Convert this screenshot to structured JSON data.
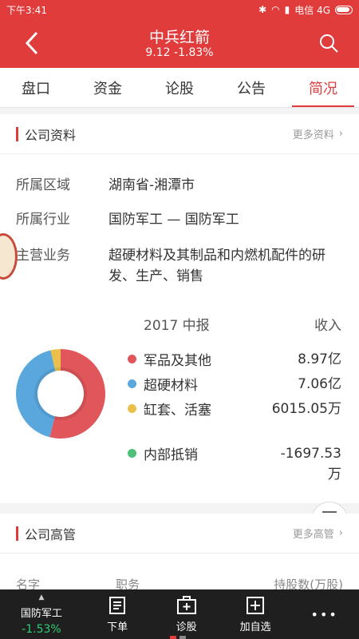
{
  "status": {
    "time": "下午3:41",
    "carrier": "电信 4G"
  },
  "header": {
    "title": "中兵红箭",
    "subtitle": "9.12  -1.83%"
  },
  "tabs": [
    "盘口",
    "资金",
    "论股",
    "公告",
    "简况"
  ],
  "active_tab": "简况",
  "company": {
    "section_title": "公司资料",
    "more_label": "更多资料",
    "region_label": "所属区域",
    "region_value": "湖南省-湘潭市",
    "industry_label": "所属行业",
    "industry_value": "国防军工 — 国防军工",
    "business_label": "主营业务",
    "business_value": "超硬材料及其制品和内燃机配件的研发、生产、销售"
  },
  "revenue": {
    "period": "2017 中报",
    "column": "收入",
    "items": [
      {
        "name": "军品及其他",
        "value": "8.97亿",
        "color": "#e0565a"
      },
      {
        "name": "超硬材料",
        "value": "7.06亿",
        "color": "#5aa7dd"
      },
      {
        "name": "缸套、活塞",
        "value": "6015.05万",
        "color": "#e9c14a"
      },
      {
        "name": "内部抵销",
        "value": "-1697.53万",
        "color": "#4fc07a"
      }
    ]
  },
  "chart_data": {
    "type": "pie",
    "title": "",
    "categories": [
      "军品及其他",
      "超硬材料",
      "缸套、活塞",
      "内部抵销"
    ],
    "values": [
      89700,
      70600,
      6015.05,
      -1697.53
    ],
    "units": "万",
    "colors": [
      "#e0565a",
      "#5aa7dd",
      "#e9c14a",
      "#4fc07a"
    ]
  },
  "executives": {
    "section_title": "公司高管",
    "more_label": "更多高管",
    "col_name": "名字",
    "col_title": "职务",
    "col_shares": "持股数(万股)"
  },
  "bottom": {
    "stock_name": "国防军工",
    "stock_change": "-1.53%",
    "order": "下单",
    "diagnose": "诊股",
    "add": "加自选",
    "more": "•••"
  }
}
